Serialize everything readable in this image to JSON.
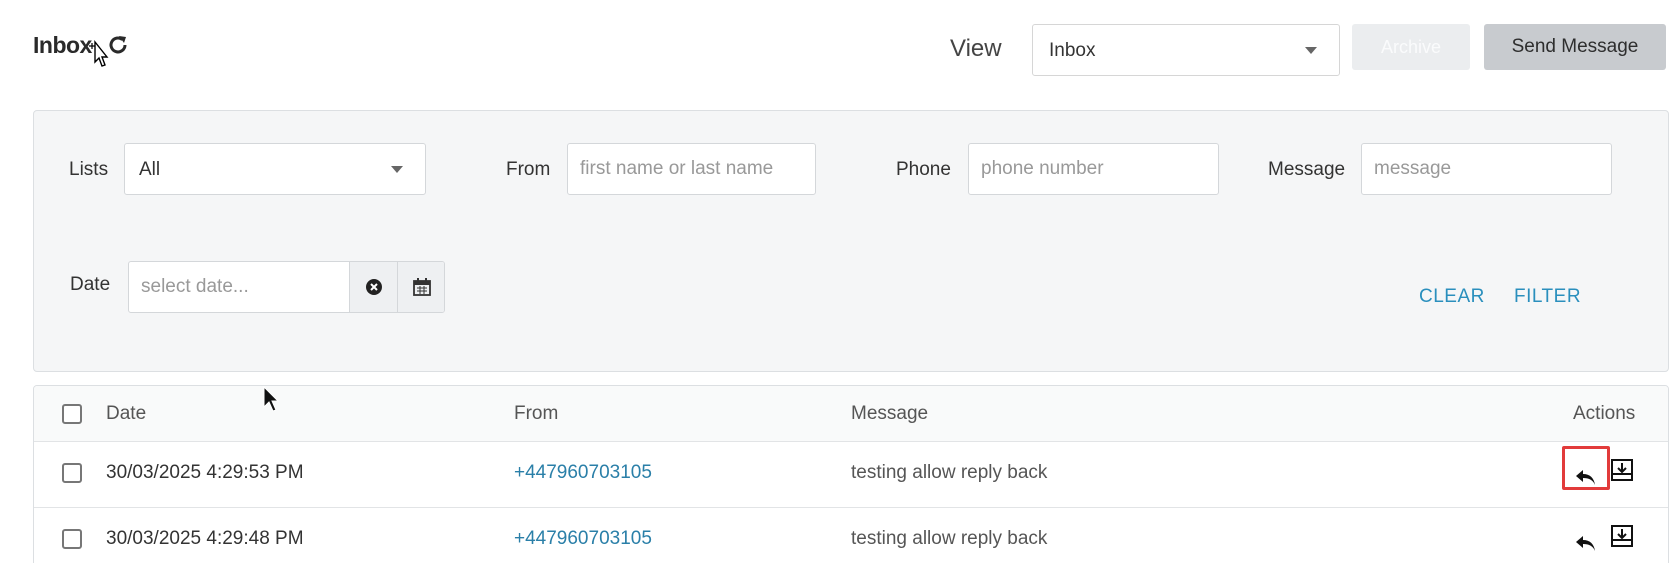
{
  "header": {
    "title": "Inbox",
    "view_label": "View",
    "view_value": "Inbox",
    "archive_label": "Archive",
    "send_label": "Send Message"
  },
  "filters": {
    "lists_label": "Lists",
    "lists_value": "All",
    "from_label": "From",
    "from_placeholder": "first name or last name",
    "phone_label": "Phone",
    "phone_placeholder": "phone number",
    "message_label": "Message",
    "message_placeholder": "message",
    "date_label": "Date",
    "date_placeholder": "select date...",
    "clear_label": "CLEAR",
    "filter_label": "FILTER"
  },
  "table": {
    "columns": [
      "Date",
      "From",
      "Message",
      "Actions"
    ],
    "rows": [
      {
        "date": "30/03/2025 4:29:53 PM",
        "from": "+447960703105",
        "message": "testing allow reply back"
      },
      {
        "date": "30/03/2025 4:29:48 PM",
        "from": "+447960703105",
        "message": "testing allow reply back"
      }
    ]
  },
  "colors": {
    "link": "#2a8fbd",
    "highlight": "#e23b3b",
    "panel": "#f5f6f7"
  },
  "icons": [
    "refresh-icon",
    "chevron-down-icon",
    "clear-circle-icon",
    "calendar-icon",
    "reply-icon",
    "download-icon",
    "mouse-pointer-icon",
    "move-cursor-icon"
  ]
}
